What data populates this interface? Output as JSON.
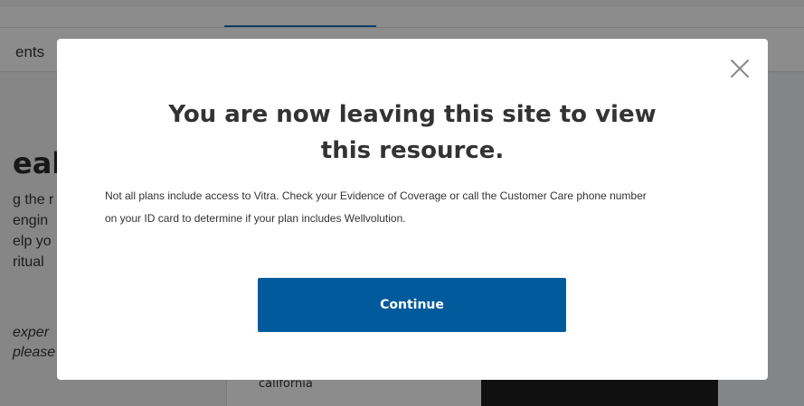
{
  "background": {
    "tab_label": "ents",
    "heading_fragment": "eal",
    "paragraph_lines": [
      "g the r",
      "engin",
      "elp yo",
      "ritual"
    ],
    "italic_lines": [
      "exper",
      "please"
    ],
    "card_caption": "california"
  },
  "modal": {
    "title_line1": "You are now leaving this site to view",
    "title_line2": "this resource.",
    "body_line1": "Not all plans include access to Vitra. Check your Evidence of Coverage or call the Customer Care phone number",
    "body_line2": "on your ID card to determine if your plan includes Wellvolution.",
    "continue_label": "Continue",
    "close_icon": "close-icon"
  },
  "colors": {
    "primary_button": "#015a9c",
    "overlay": "rgba(0,0,0,0.45)",
    "title_text": "#333333",
    "tab_accent": "#1b6fb8"
  }
}
